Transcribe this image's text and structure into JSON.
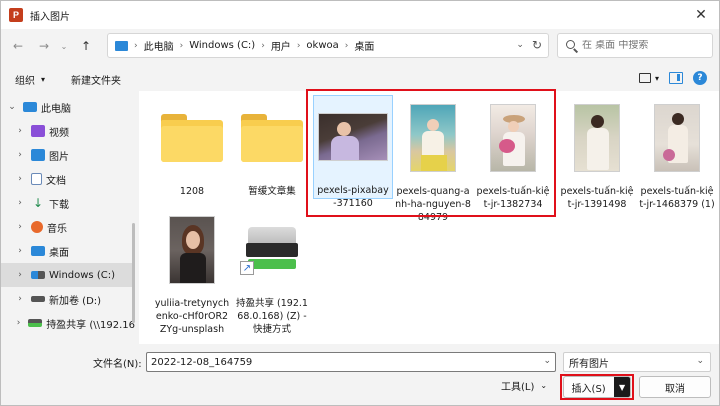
{
  "window": {
    "title": "插入图片"
  },
  "address": {
    "segments": [
      "此电脑",
      "Windows (C:)",
      "用户",
      "okwoa",
      "桌面"
    ]
  },
  "search": {
    "placeholder": "在 桌面 中搜索"
  },
  "commands": {
    "organize": "组织",
    "new_folder": "新建文件夹"
  },
  "sidebar": {
    "items": [
      {
        "label": "此电脑",
        "icon": "pc-icon",
        "expanded": true
      },
      {
        "label": "视频",
        "icon": "video-icon"
      },
      {
        "label": "图片",
        "icon": "pictures-icon"
      },
      {
        "label": "文档",
        "icon": "documents-icon"
      },
      {
        "label": "下载",
        "icon": "download-icon"
      },
      {
        "label": "音乐",
        "icon": "music-icon"
      },
      {
        "label": "桌面",
        "icon": "desktop-icon"
      },
      {
        "label": "Windows (C:)",
        "icon": "windows-drive-icon",
        "selected": true
      },
      {
        "label": "新加卷 (D:)",
        "icon": "drive-icon"
      },
      {
        "label": "持盈共享 (\\\\192.16",
        "icon": "network-drive-icon"
      }
    ]
  },
  "files": [
    {
      "name": "1208",
      "kind": "folder"
    },
    {
      "name": "暂缓文章集",
      "kind": "folder"
    },
    {
      "name": "pexels-pixabay-371160",
      "kind": "image",
      "selected": true
    },
    {
      "name": "pexels-quang-anh-ha-nguyen-884979",
      "kind": "image"
    },
    {
      "name": "pexels-tuấn-kiệt-jr-1382734",
      "kind": "image"
    },
    {
      "name": "pexels-tuấn-kiệt-jr-1391498",
      "kind": "image"
    },
    {
      "name": "pexels-tuấn-kiệt-jr-1468379 (1)",
      "kind": "image"
    },
    {
      "name": "yuliia-tretynychenko-cHf0rOR2ZYg-unsplash",
      "kind": "image"
    },
    {
      "name": "持盈共享 (192.168.0.168) (Z) - 快捷方式",
      "kind": "shortcut"
    }
  ],
  "footer": {
    "filename_label": "文件名(N):",
    "filename_value": "2022-12-08_164759",
    "filetype_value": "所有图片",
    "tools_label": "工具(L)",
    "insert_label": "插入(S)",
    "cancel_label": "取消"
  },
  "colors": {
    "accent": "#2b88d8",
    "highlight": "#e0101a",
    "folder": "#f8cd4e"
  }
}
